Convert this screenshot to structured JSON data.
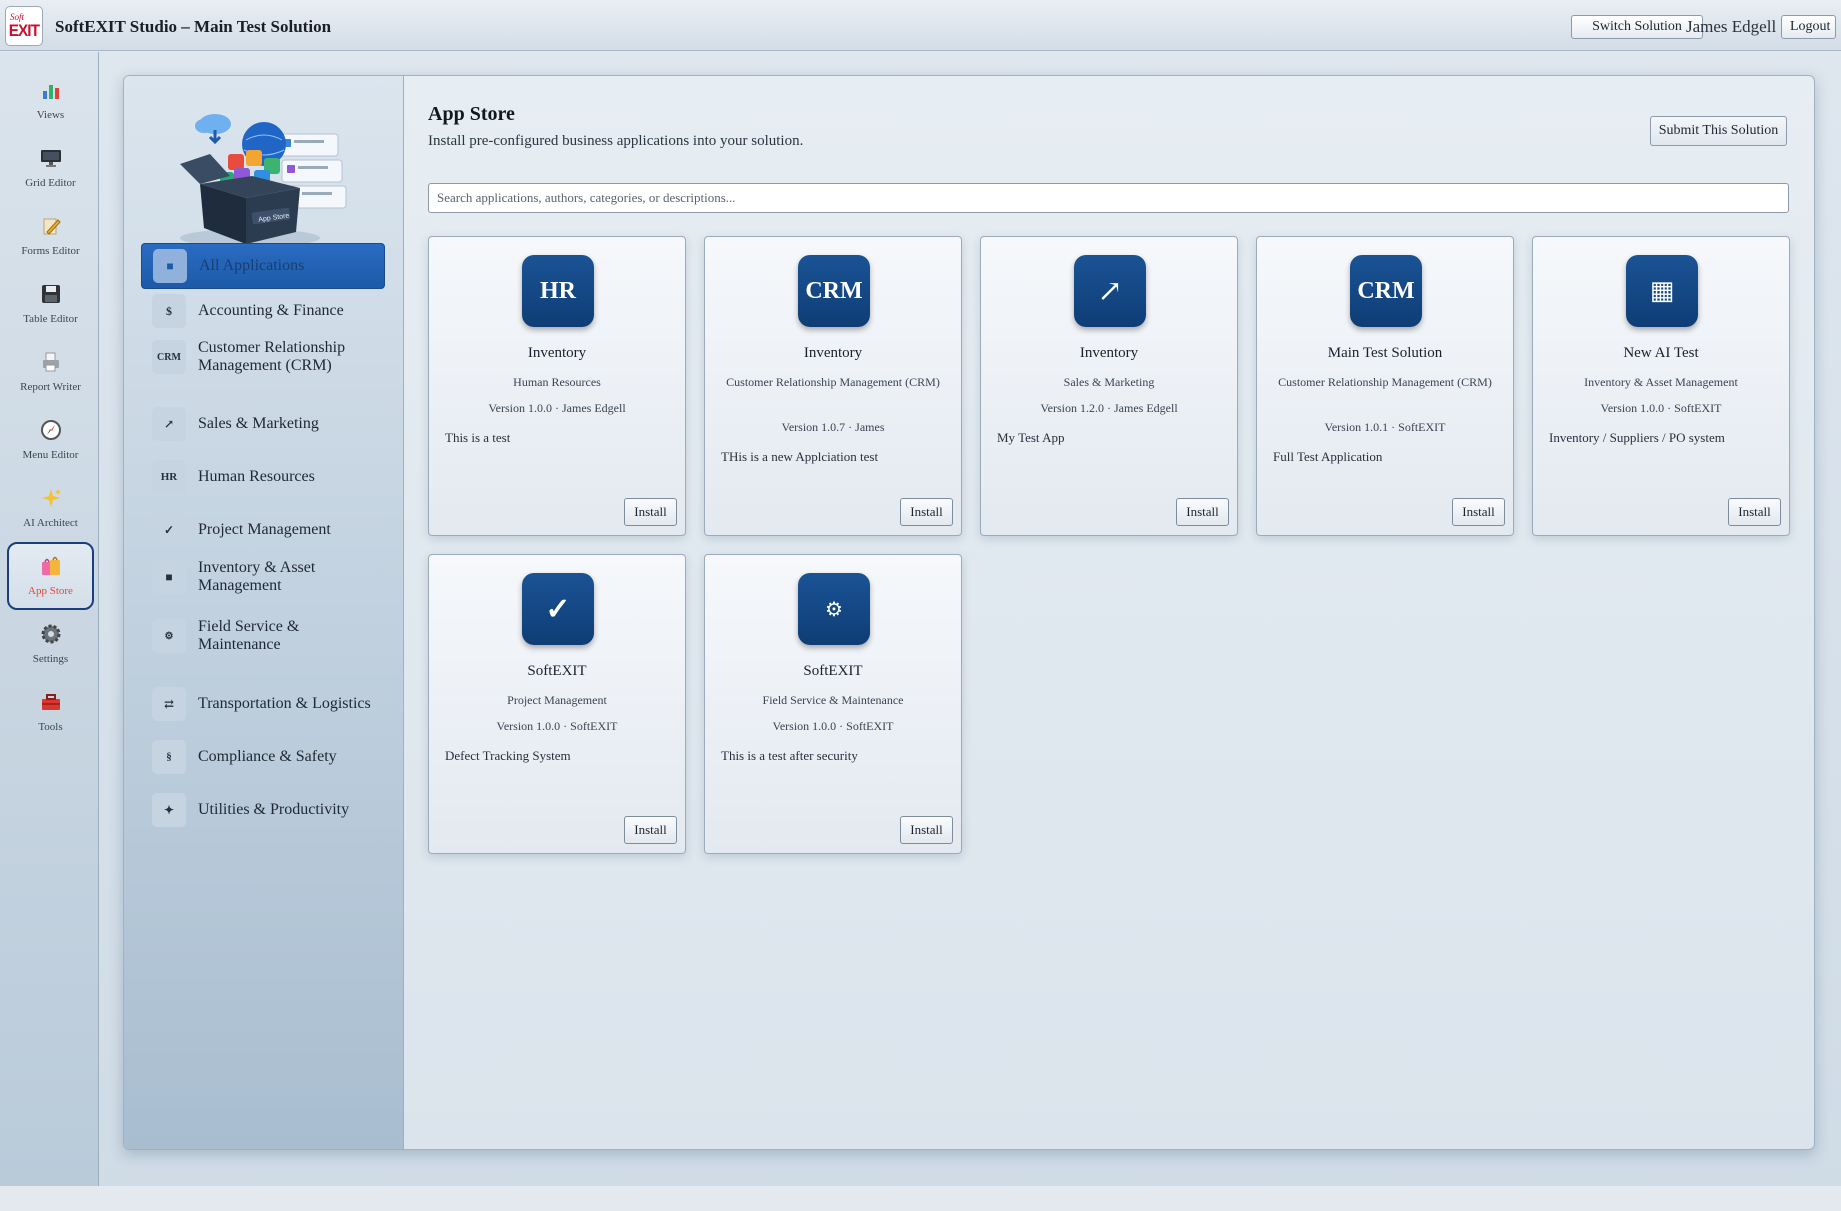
{
  "header": {
    "logo_small": "Soft",
    "logo_big": "EXIT",
    "title": "SoftEXIT Studio – Main Test Solution",
    "switch_label": "Switch Solution",
    "user": "James Edgell",
    "logout_label": "Logout"
  },
  "rail": [
    {
      "label": "Views",
      "icon": "bar-chart-icon"
    },
    {
      "label": "Grid Editor",
      "icon": "monitor-icon"
    },
    {
      "label": "Forms Editor",
      "icon": "pencil-icon"
    },
    {
      "label": "Table Editor",
      "icon": "floppy-disk-icon"
    },
    {
      "label": "Report Writer",
      "icon": "printer-icon"
    },
    {
      "label": "Menu Editor",
      "icon": "compass-icon"
    },
    {
      "label": "AI Architect",
      "icon": "sparkles-icon"
    },
    {
      "label": "App Store",
      "icon": "shopping-bags-icon",
      "active": true
    },
    {
      "label": "Settings",
      "icon": "gear-icon"
    },
    {
      "label": "Tools",
      "icon": "toolbox-icon"
    }
  ],
  "hero": {
    "box_label": "App Store"
  },
  "categories": [
    {
      "label": "All Applications",
      "icon": "■",
      "active": true
    },
    {
      "label": "Accounting & Finance",
      "icon": "$"
    },
    {
      "label": "Customer Relationship Management (CRM)",
      "icon": "CRM"
    },
    {
      "label": "Sales & Marketing",
      "icon": "↗"
    },
    {
      "label": "Human Resources",
      "icon": "HR"
    },
    {
      "label": "Project Management",
      "icon": "✓"
    },
    {
      "label": "Inventory & Asset Management",
      "icon": "■"
    },
    {
      "label": "Field Service & Maintenance",
      "icon": "⚙"
    },
    {
      "label": "Transportation & Logistics",
      "icon": "⇄"
    },
    {
      "label": "Compliance & Safety",
      "icon": "§"
    },
    {
      "label": "Utilities & Productivity",
      "icon": "✦"
    }
  ],
  "main": {
    "title": "App Store",
    "subtitle": "Install pre-configured business applications into your solution.",
    "submit_label": "Submit This Solution",
    "search_placeholder": "Search applications, authors, categories, or descriptions..."
  },
  "apps": [
    {
      "icon_text": "HR",
      "name": "Inventory",
      "category": "Human Resources",
      "version": "Version 1.0.0 · James Edgell",
      "description": "This is a test",
      "install_label": "Install"
    },
    {
      "icon_text": "CRM",
      "name": "Inventory",
      "category": "Customer Relationship Management (CRM)",
      "version": "Version 1.0.7 · James",
      "description": "THis is a new Applciation test",
      "install_label": "Install"
    },
    {
      "icon_text": "↗",
      "name": "Inventory",
      "category": "Sales & Marketing",
      "version": "Version 1.2.0 · James Edgell",
      "description": "My Test App",
      "install_label": "Install"
    },
    {
      "icon_text": "CRM",
      "name": "Main Test Solution",
      "category": "Customer Relationship Management (CRM)",
      "version": "Version 1.0.1 · SoftEXIT",
      "description": "Full Test Application",
      "install_label": "Install"
    },
    {
      "icon_text": "▦",
      "name": "New AI Test",
      "category": "Inventory & Asset Management",
      "version": "Version 1.0.0 · SoftEXIT",
      "description": "Inventory / Suppliers / PO system",
      "install_label": "Install"
    },
    {
      "icon_text": "✓",
      "name": "SoftEXIT",
      "category": "Project Management",
      "version": "Version 1.0.0 · SoftEXIT",
      "description": "Defect Tracking System",
      "install_label": "Install"
    },
    {
      "icon_text": "⚙",
      "name": "SoftEXIT",
      "category": "Field Service & Maintenance",
      "version": "Version 1.0.0 · SoftEXIT",
      "description": "This is a test after security",
      "install_label": "Install"
    }
  ],
  "colors": {
    "accent": "#1d5aa8",
    "app_icon": "#0f3d75",
    "active_rail_text": "#e3463a",
    "logo_red": "#c8102e"
  }
}
